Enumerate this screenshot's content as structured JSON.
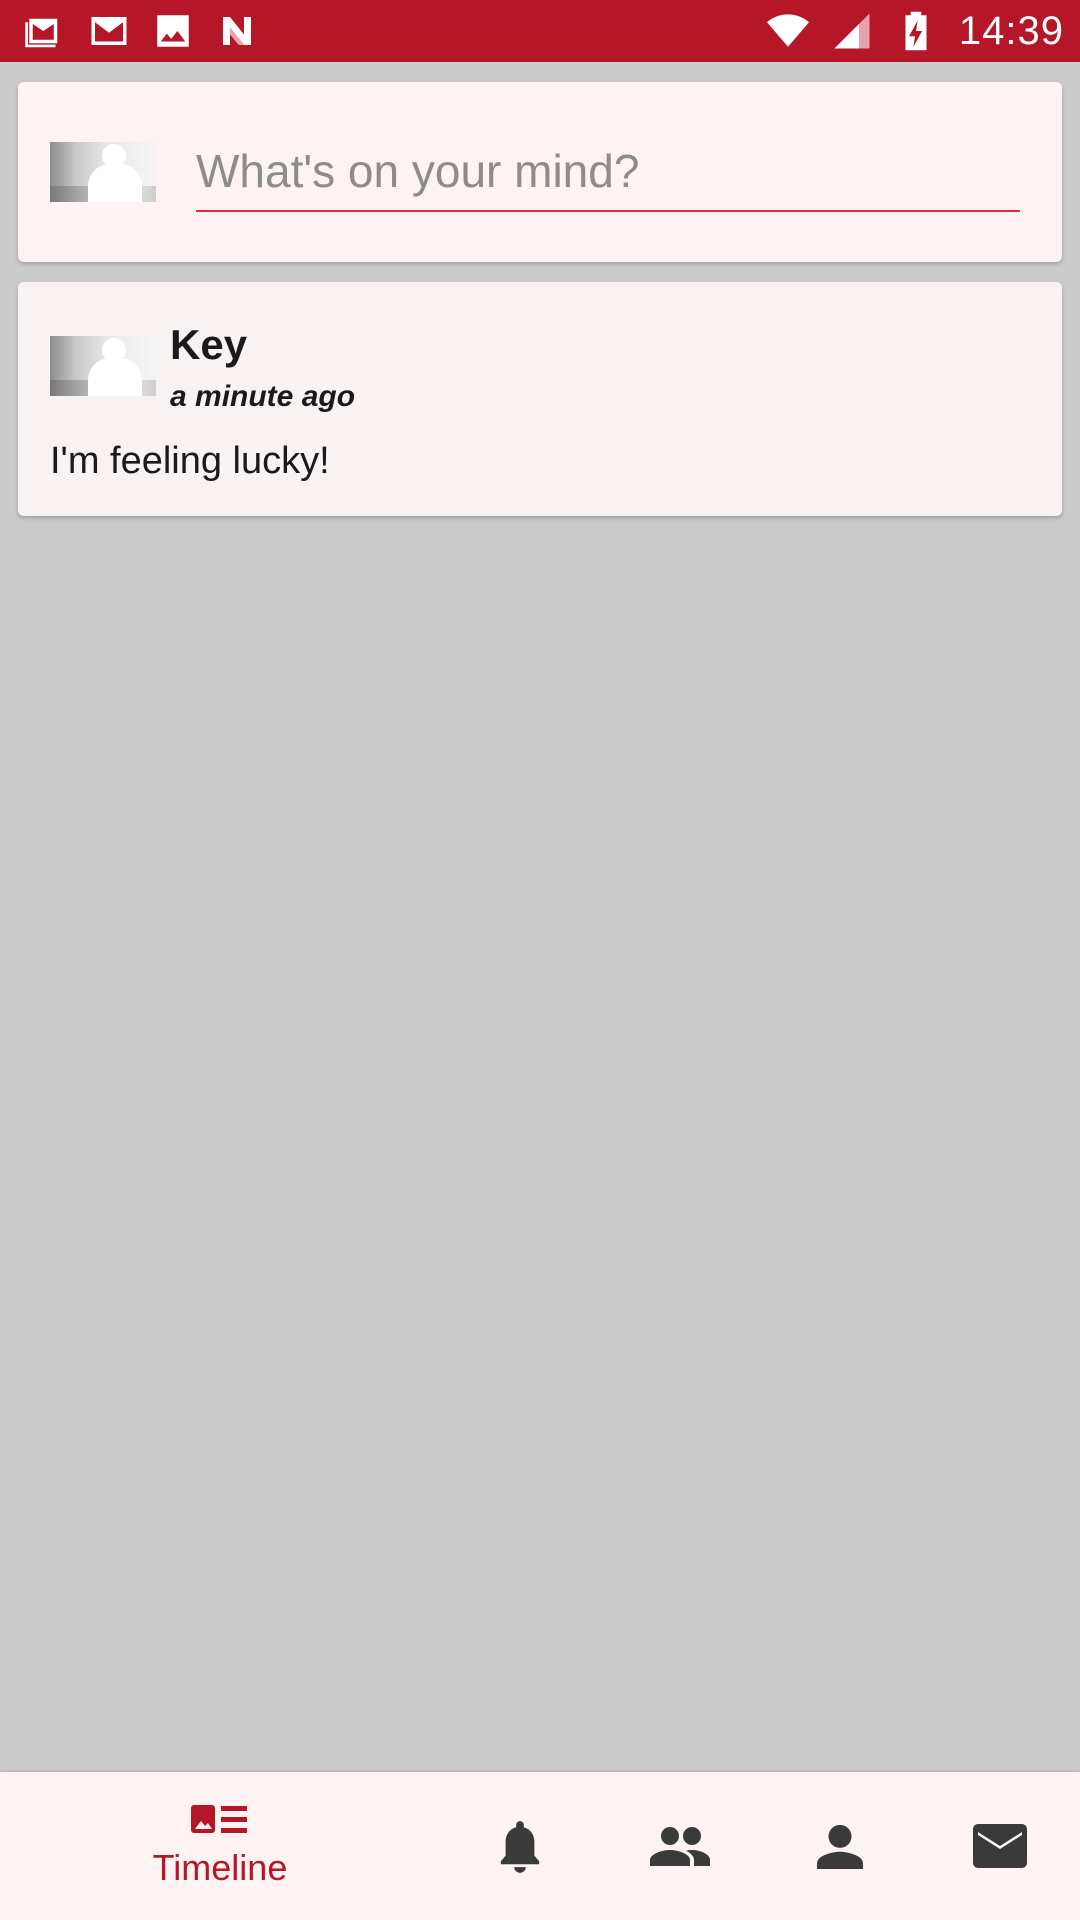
{
  "status_bar": {
    "time": "14:39",
    "icons_left": [
      "gmail-stack-icon",
      "gmail-icon",
      "image-icon",
      "n-app-icon"
    ],
    "icons_right": [
      "wifi-icon",
      "signal-icon",
      "battery-charging-icon"
    ],
    "color": "#b51628"
  },
  "composer": {
    "placeholder": "What's on your mind?",
    "underline_color": "#d9303f"
  },
  "posts": [
    {
      "author": "Key",
      "time": "a minute ago",
      "body": "I'm feeling lucky!"
    }
  ],
  "bottom_nav": {
    "items": [
      {
        "label": "Timeline",
        "icon": "timeline-icon",
        "active": true
      },
      {
        "label": "",
        "icon": "bell-icon",
        "active": false
      },
      {
        "label": "",
        "icon": "people-icon",
        "active": false
      },
      {
        "label": "",
        "icon": "person-icon",
        "active": false
      },
      {
        "label": "",
        "icon": "mail-icon",
        "active": false
      }
    ],
    "active_color": "#b51628",
    "inactive_color": "#3a3a3a"
  }
}
